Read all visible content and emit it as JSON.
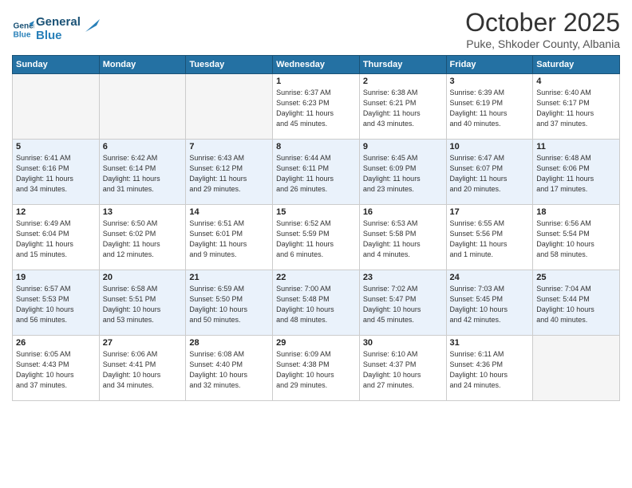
{
  "header": {
    "logo_line1": "General",
    "logo_line2": "Blue",
    "month": "October 2025",
    "location": "Puke, Shkoder County, Albania"
  },
  "days_of_week": [
    "Sunday",
    "Monday",
    "Tuesday",
    "Wednesday",
    "Thursday",
    "Friday",
    "Saturday"
  ],
  "weeks": [
    [
      {
        "day": "",
        "info": ""
      },
      {
        "day": "",
        "info": ""
      },
      {
        "day": "",
        "info": ""
      },
      {
        "day": "1",
        "info": "Sunrise: 6:37 AM\nSunset: 6:23 PM\nDaylight: 11 hours\nand 45 minutes."
      },
      {
        "day": "2",
        "info": "Sunrise: 6:38 AM\nSunset: 6:21 PM\nDaylight: 11 hours\nand 43 minutes."
      },
      {
        "day": "3",
        "info": "Sunrise: 6:39 AM\nSunset: 6:19 PM\nDaylight: 11 hours\nand 40 minutes."
      },
      {
        "day": "4",
        "info": "Sunrise: 6:40 AM\nSunset: 6:17 PM\nDaylight: 11 hours\nand 37 minutes."
      }
    ],
    [
      {
        "day": "5",
        "info": "Sunrise: 6:41 AM\nSunset: 6:16 PM\nDaylight: 11 hours\nand 34 minutes."
      },
      {
        "day": "6",
        "info": "Sunrise: 6:42 AM\nSunset: 6:14 PM\nDaylight: 11 hours\nand 31 minutes."
      },
      {
        "day": "7",
        "info": "Sunrise: 6:43 AM\nSunset: 6:12 PM\nDaylight: 11 hours\nand 29 minutes."
      },
      {
        "day": "8",
        "info": "Sunrise: 6:44 AM\nSunset: 6:11 PM\nDaylight: 11 hours\nand 26 minutes."
      },
      {
        "day": "9",
        "info": "Sunrise: 6:45 AM\nSunset: 6:09 PM\nDaylight: 11 hours\nand 23 minutes."
      },
      {
        "day": "10",
        "info": "Sunrise: 6:47 AM\nSunset: 6:07 PM\nDaylight: 11 hours\nand 20 minutes."
      },
      {
        "day": "11",
        "info": "Sunrise: 6:48 AM\nSunset: 6:06 PM\nDaylight: 11 hours\nand 17 minutes."
      }
    ],
    [
      {
        "day": "12",
        "info": "Sunrise: 6:49 AM\nSunset: 6:04 PM\nDaylight: 11 hours\nand 15 minutes."
      },
      {
        "day": "13",
        "info": "Sunrise: 6:50 AM\nSunset: 6:02 PM\nDaylight: 11 hours\nand 12 minutes."
      },
      {
        "day": "14",
        "info": "Sunrise: 6:51 AM\nSunset: 6:01 PM\nDaylight: 11 hours\nand 9 minutes."
      },
      {
        "day": "15",
        "info": "Sunrise: 6:52 AM\nSunset: 5:59 PM\nDaylight: 11 hours\nand 6 minutes."
      },
      {
        "day": "16",
        "info": "Sunrise: 6:53 AM\nSunset: 5:58 PM\nDaylight: 11 hours\nand 4 minutes."
      },
      {
        "day": "17",
        "info": "Sunrise: 6:55 AM\nSunset: 5:56 PM\nDaylight: 11 hours\nand 1 minute."
      },
      {
        "day": "18",
        "info": "Sunrise: 6:56 AM\nSunset: 5:54 PM\nDaylight: 10 hours\nand 58 minutes."
      }
    ],
    [
      {
        "day": "19",
        "info": "Sunrise: 6:57 AM\nSunset: 5:53 PM\nDaylight: 10 hours\nand 56 minutes."
      },
      {
        "day": "20",
        "info": "Sunrise: 6:58 AM\nSunset: 5:51 PM\nDaylight: 10 hours\nand 53 minutes."
      },
      {
        "day": "21",
        "info": "Sunrise: 6:59 AM\nSunset: 5:50 PM\nDaylight: 10 hours\nand 50 minutes."
      },
      {
        "day": "22",
        "info": "Sunrise: 7:00 AM\nSunset: 5:48 PM\nDaylight: 10 hours\nand 48 minutes."
      },
      {
        "day": "23",
        "info": "Sunrise: 7:02 AM\nSunset: 5:47 PM\nDaylight: 10 hours\nand 45 minutes."
      },
      {
        "day": "24",
        "info": "Sunrise: 7:03 AM\nSunset: 5:45 PM\nDaylight: 10 hours\nand 42 minutes."
      },
      {
        "day": "25",
        "info": "Sunrise: 7:04 AM\nSunset: 5:44 PM\nDaylight: 10 hours\nand 40 minutes."
      }
    ],
    [
      {
        "day": "26",
        "info": "Sunrise: 6:05 AM\nSunset: 4:43 PM\nDaylight: 10 hours\nand 37 minutes."
      },
      {
        "day": "27",
        "info": "Sunrise: 6:06 AM\nSunset: 4:41 PM\nDaylight: 10 hours\nand 34 minutes."
      },
      {
        "day": "28",
        "info": "Sunrise: 6:08 AM\nSunset: 4:40 PM\nDaylight: 10 hours\nand 32 minutes."
      },
      {
        "day": "29",
        "info": "Sunrise: 6:09 AM\nSunset: 4:38 PM\nDaylight: 10 hours\nand 29 minutes."
      },
      {
        "day": "30",
        "info": "Sunrise: 6:10 AM\nSunset: 4:37 PM\nDaylight: 10 hours\nand 27 minutes."
      },
      {
        "day": "31",
        "info": "Sunrise: 6:11 AM\nSunset: 4:36 PM\nDaylight: 10 hours\nand 24 minutes."
      },
      {
        "day": "",
        "info": ""
      }
    ]
  ]
}
